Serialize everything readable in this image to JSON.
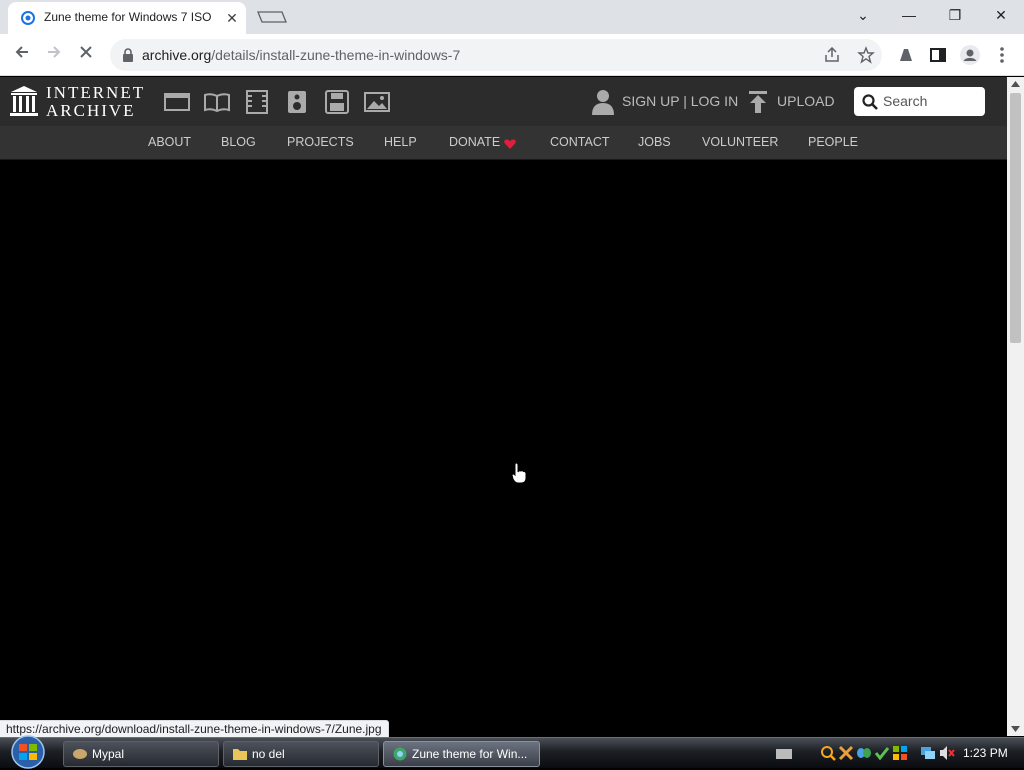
{
  "browser": {
    "tab_title": "Zune theme for Windows 7 ISO",
    "tab_close": "✕",
    "url_host": "archive.org",
    "url_path": "/details/install-zune-theme-in-windows-7",
    "window_controls": {
      "minimize": "—",
      "restore": "❐",
      "close": "✕",
      "tab_search": "⌄"
    }
  },
  "ia_header": {
    "logo_line1": "INTERNET",
    "logo_line2": "ARCHIVE",
    "signup_login": "SIGN UP | LOG IN",
    "upload": "UPLOAD",
    "search_placeholder": "Search",
    "media_icons": [
      "web-icon",
      "texts-icon",
      "video-icon",
      "audio-icon",
      "software-icon",
      "images-icon"
    ]
  },
  "nav": {
    "items": [
      "ABOUT",
      "BLOG",
      "PROJECTS",
      "HELP",
      "DONATE",
      "CONTACT",
      "JOBS",
      "VOLUNTEER",
      "PEOPLE"
    ]
  },
  "status_bar": {
    "link": "https://archive.org/download/install-zune-theme-in-windows-7/Zune.jpg"
  },
  "taskbar": {
    "tasks": [
      "Mypal",
      "no del",
      "Zune theme for Win..."
    ],
    "clock": "1:23 PM"
  },
  "colors": {
    "ia_header": "#2c2c2c",
    "ia_nav": "#333333",
    "donate_heart": "#e01f3d",
    "page_bg": "#000000"
  }
}
